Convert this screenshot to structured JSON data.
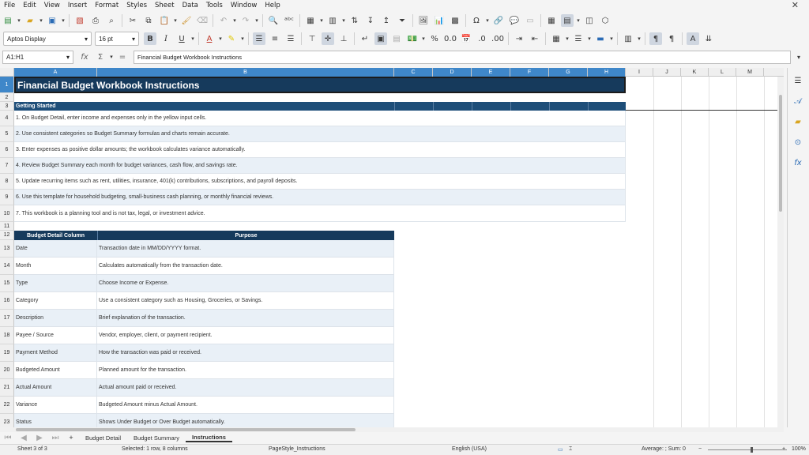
{
  "menu": [
    "File",
    "Edit",
    "View",
    "Insert",
    "Format",
    "Styles",
    "Sheet",
    "Data",
    "Tools",
    "Window",
    "Help"
  ],
  "font": {
    "name": "Aptos Display",
    "size": "16 pt"
  },
  "formula_bar": {
    "cell_ref": "A1:H1",
    "content": "Financial Budget Workbook Instructions"
  },
  "columns": [
    "A",
    "B",
    "C",
    "D",
    "E",
    "F",
    "G",
    "H",
    "I",
    "J",
    "K",
    "L",
    "M"
  ],
  "title": "Financial Budget Workbook Instructions",
  "getting_started_header": "Getting Started",
  "instructions": [
    "1. On Budget Detail, enter income and expenses only in the yellow input cells.",
    "2. Use consistent categories so Budget Summary formulas and charts remain accurate.",
    "3. Enter expenses as positive dollar amounts; the workbook calculates variance automatically.",
    "4. Review Budget Summary each month for budget variances, cash flow, and savings rate.",
    "5. Update recurring items such as rent, utilities, insurance, 401(k) contributions, subscriptions, and payroll deposits.",
    "6. Use this template for household budgeting, small-business cash planning, or monthly financial reviews.",
    "7. This workbook is a planning tool and is not tax, legal, or investment advice."
  ],
  "table_headers": {
    "column": "Budget Detail Column",
    "purpose": "Purpose"
  },
  "table_rows": [
    {
      "column": "Date",
      "purpose": "Transaction date in MM/DD/YYYY format."
    },
    {
      "column": "Month",
      "purpose": "Calculates automatically from the transaction date."
    },
    {
      "column": "Type",
      "purpose": "Choose Income or Expense."
    },
    {
      "column": "Category",
      "purpose": "Use a consistent category such as Housing, Groceries, or Savings."
    },
    {
      "column": "Description",
      "purpose": "Brief explanation of the transaction."
    },
    {
      "column": "Payee / Source",
      "purpose": "Vendor, employer, client, or payment recipient."
    },
    {
      "column": "Payment Method",
      "purpose": "How the transaction was paid or received."
    },
    {
      "column": "Budgeted Amount",
      "purpose": "Planned amount for the transaction."
    },
    {
      "column": "Actual Amount",
      "purpose": "Actual amount paid or received."
    },
    {
      "column": "Variance",
      "purpose": "Budgeted Amount minus Actual Amount."
    },
    {
      "column": "Status",
      "purpose": "Shows Under Budget or Over Budget automatically."
    }
  ],
  "row_numbers": [
    "1",
    "2",
    "3",
    "4",
    "5",
    "6",
    "7",
    "8",
    "9",
    "10",
    "11",
    "12",
    "13",
    "14",
    "15",
    "16",
    "17",
    "18",
    "19",
    "20",
    "21",
    "22",
    "23"
  ],
  "tabs": [
    "Budget Detail",
    "Budget Summary",
    "Instructions"
  ],
  "tab_add": "+",
  "status": {
    "sheet": "Sheet 3 of 3",
    "selection": "Selected: 1 row, 8 columns",
    "page_style": "PageStyle_Instructions",
    "language": "English (USA)",
    "summary": "Average: ; Sum: 0",
    "zoom": "100%"
  },
  "colors": {
    "header_dark": "#163a5c",
    "header_mid": "#1e4e79",
    "band": "#e9f0f7",
    "selection": "#3f87c9"
  }
}
